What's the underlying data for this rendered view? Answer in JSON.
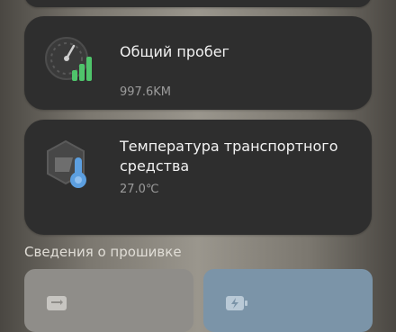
{
  "odometer": {
    "title": "Общий пробег",
    "value": "997.6KM",
    "icon": "odometer-gauge-icon"
  },
  "temperature": {
    "title": "Температура транспортного средства",
    "value": "27.0℃",
    "icon": "vehicle-temperature-icon"
  },
  "firmware": {
    "header": "Сведения о прошивке",
    "tiles": [
      {
        "icon": "firmware-module-icon",
        "color": "#8f8d89"
      },
      {
        "icon": "battery-charge-icon",
        "color": "#7b94a8"
      }
    ]
  },
  "colors": {
    "card_bg": "#2e2e2e",
    "accent_green": "#4fc46b",
    "accent_blue": "#5c9fe0"
  }
}
